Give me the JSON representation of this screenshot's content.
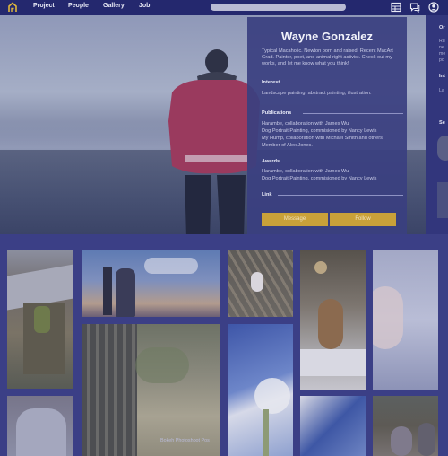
{
  "nav": {
    "links": [
      "Project",
      "People",
      "Gallery",
      "Job"
    ],
    "icons": [
      "logo-house-icon",
      "grid-icon",
      "chat-icon",
      "user-icon"
    ],
    "colors": {
      "bar": "#24286e",
      "search": "#b9bbd4"
    }
  },
  "profile": {
    "name": "Wayne Gonzalez",
    "bio": "Typical Macaholic. Newton born and raised. Recent MacArt Grad. Painter, poet, and animal right activist. Check out my works, and let me know what you think!",
    "sections": {
      "interest": {
        "heading": "Interest",
        "text": "Landscape painting, abstract painting, illustration."
      },
      "publications": {
        "heading": "Publications",
        "items": [
          "Harambe, collaboration with James Wu",
          "Dog Portrait Painting, commisioned by Nancy Lewis",
          "My Hump, collaboration with Michael Smith and others",
          "Member of Alex Jones."
        ]
      },
      "awards": {
        "heading": "Awards",
        "items": [
          "Harambe, collaboration with James Wu",
          "Dog Portrait Painting, commisioned by Nancy Lewis"
        ]
      },
      "link": {
        "heading": "Link"
      }
    },
    "buttons": {
      "message": "Message",
      "follow": "Follow"
    },
    "colors": {
      "card": "#3a3f80",
      "button": "#c9a139"
    }
  },
  "side": {
    "title1": "Or",
    "lines1": [
      "Ru",
      "ne",
      "me",
      "po"
    ],
    "title2": "Int",
    "lines2": [
      "La"
    ],
    "title3": "Se"
  },
  "gallery": {
    "caption": "Bokeh Photoshoot Pos"
  }
}
